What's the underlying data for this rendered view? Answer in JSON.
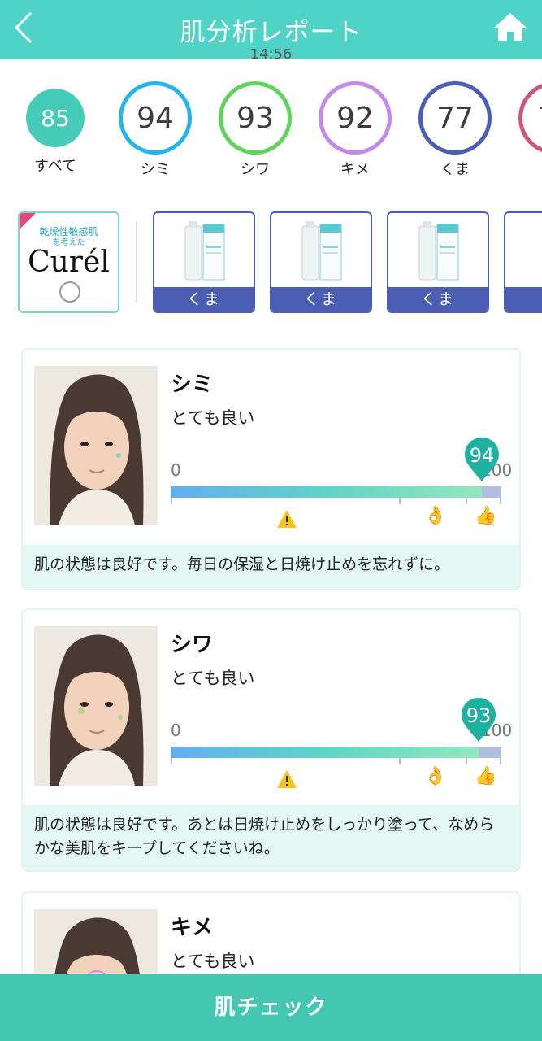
{
  "header": {
    "title": "肌分析レポート"
  },
  "timestamp": "14:56",
  "scores": [
    {
      "value": "85",
      "label": "すべて",
      "color": "#46cbb8",
      "filled": true
    },
    {
      "value": "94",
      "label": "シミ",
      "color": "#25b4ee"
    },
    {
      "value": "93",
      "label": "シワ",
      "color": "#5fd35a"
    },
    {
      "value": "92",
      "label": "キメ",
      "color": "#c48ae8"
    },
    {
      "value": "77",
      "label": "くま",
      "color": "#4c5db4"
    },
    {
      "value": "7",
      "label": "",
      "color": "#d0557a"
    }
  ],
  "brand": {
    "subtitle_line1": "乾燥性敏感肌",
    "subtitle_line2": "を考えた",
    "logo": "Curél"
  },
  "products": [
    {
      "tag": "くま"
    },
    {
      "tag": "くま"
    },
    {
      "tag": "くま"
    }
  ],
  "cards": [
    {
      "title": "シミ",
      "grade": "とても良い",
      "score": "94",
      "score_value": 94,
      "scale_min": "0",
      "scale_max": "100",
      "comment": "肌の状態は良好です。毎日の保湿と日焼け止めを忘れずに。"
    },
    {
      "title": "シワ",
      "grade": "とても良い",
      "score": "93",
      "score_value": 93,
      "scale_min": "0",
      "scale_max": "100",
      "comment": "肌の状態は良好です。あとは日焼け止めをしっかり塗って、なめらかな美肌をキープしてくださいね。"
    },
    {
      "title": "キメ",
      "grade": "とても良い"
    }
  ],
  "icons": {
    "warning": "warning-icon",
    "ok": "ok-hand-icon",
    "good": "thumbs-up-icon"
  },
  "colors": {
    "accent": "#4fd3c6",
    "pin": "#1eb0a0",
    "cta": "#45c6b1",
    "comment_bg": "#e4f8f3"
  },
  "cta": {
    "label": "肌チェック"
  }
}
